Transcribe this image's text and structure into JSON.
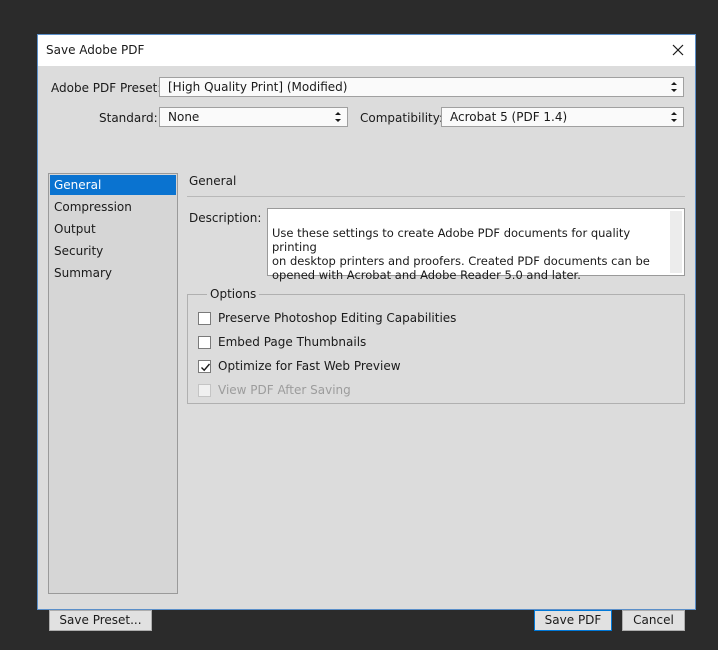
{
  "window": {
    "title": "Save Adobe PDF"
  },
  "preset": {
    "label": "Adobe PDF Preset:",
    "value": "[High Quality Print] (Modified)"
  },
  "standard": {
    "label": "Standard:",
    "value": "None"
  },
  "compatibility": {
    "label": "Compatibility:",
    "value": "Acrobat 5 (PDF 1.4)"
  },
  "sidebar": {
    "items": [
      {
        "label": "General",
        "selected": true
      },
      {
        "label": "Compression",
        "selected": false
      },
      {
        "label": "Output",
        "selected": false
      },
      {
        "label": "Security",
        "selected": false
      },
      {
        "label": "Summary",
        "selected": false
      }
    ]
  },
  "panel": {
    "title": "General",
    "description_label": "Description:",
    "description_text": "Use these settings to create Adobe PDF documents for quality printing\non desktop printers and proofers.  Created PDF documents can be\nopened with Acrobat and Adobe Reader 5.0 and later."
  },
  "options": {
    "legend": "Options",
    "items": [
      {
        "label": "Preserve Photoshop Editing Capabilities",
        "checked": false,
        "enabled": true
      },
      {
        "label": "Embed Page Thumbnails",
        "checked": false,
        "enabled": true
      },
      {
        "label": "Optimize for Fast Web Preview",
        "checked": true,
        "enabled": true
      },
      {
        "label": "View PDF After Saving",
        "checked": false,
        "enabled": false
      }
    ]
  },
  "buttons": {
    "save_preset": "Save Preset...",
    "save_pdf": "Save PDF",
    "cancel": "Cancel"
  },
  "colors": {
    "selection": "#0a73d0",
    "accent_border": "#0078d7",
    "backdrop": "#2b2b2b"
  }
}
